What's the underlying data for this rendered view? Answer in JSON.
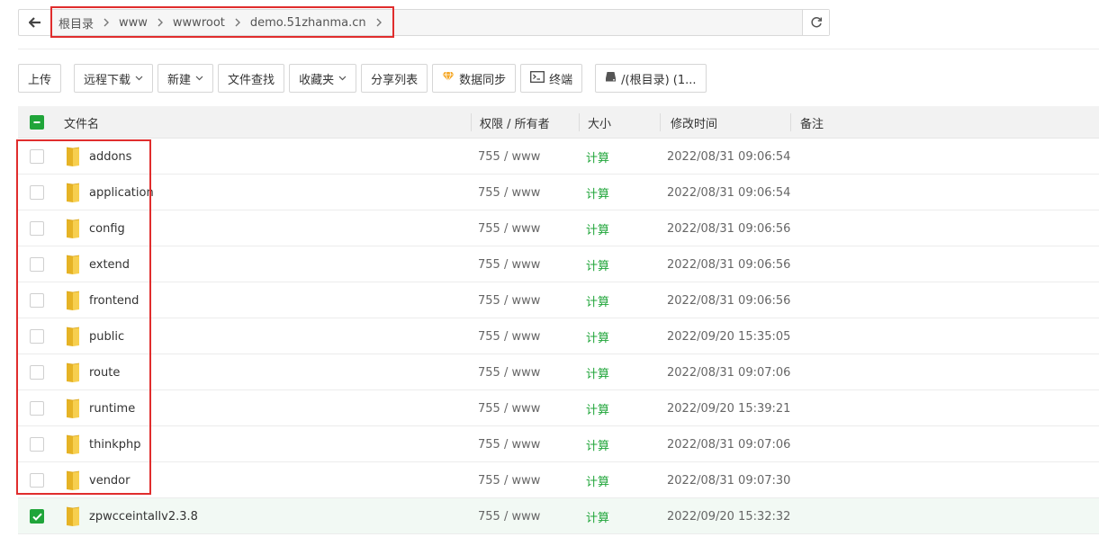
{
  "pathbar": {
    "crumbs": [
      "根目录",
      "www",
      "wwwroot",
      "demo.51zhanma.cn"
    ]
  },
  "toolbar": {
    "upload": "上传",
    "remote_download": "远程下载",
    "new": "新建",
    "file_search": "文件查找",
    "favorites": "收藏夹",
    "share_list": "分享列表",
    "data_sync": "数据同步",
    "terminal": "终端",
    "disk": "/(根目录) (1..."
  },
  "table": {
    "headers": {
      "name": "文件名",
      "perm": "权限 / 所有者",
      "size": "大小",
      "mtime": "修改时间",
      "remark": "备注"
    },
    "rows": [
      {
        "name": "addons",
        "perm": "755 / www",
        "size": "计算",
        "mtime": "2022/08/31 09:06:54",
        "checked": false
      },
      {
        "name": "application",
        "perm": "755 / www",
        "size": "计算",
        "mtime": "2022/08/31 09:06:54",
        "checked": false
      },
      {
        "name": "config",
        "perm": "755 / www",
        "size": "计算",
        "mtime": "2022/08/31 09:06:56",
        "checked": false
      },
      {
        "name": "extend",
        "perm": "755 / www",
        "size": "计算",
        "mtime": "2022/08/31 09:06:56",
        "checked": false
      },
      {
        "name": "frontend",
        "perm": "755 / www",
        "size": "计算",
        "mtime": "2022/08/31 09:06:56",
        "checked": false
      },
      {
        "name": "public",
        "perm": "755 / www",
        "size": "计算",
        "mtime": "2022/09/20 15:35:05",
        "checked": false
      },
      {
        "name": "route",
        "perm": "755 / www",
        "size": "计算",
        "mtime": "2022/08/31 09:07:06",
        "checked": false
      },
      {
        "name": "runtime",
        "perm": "755 / www",
        "size": "计算",
        "mtime": "2022/09/20 15:39:21",
        "checked": false
      },
      {
        "name": "thinkphp",
        "perm": "755 / www",
        "size": "计算",
        "mtime": "2022/08/31 09:07:06",
        "checked": false
      },
      {
        "name": "vendor",
        "perm": "755 / www",
        "size": "计算",
        "mtime": "2022/08/31 09:07:30",
        "checked": false
      },
      {
        "name": "zpwcceintallv2.3.8",
        "perm": "755 / www",
        "size": "计算",
        "mtime": "2022/09/20 15:32:32",
        "checked": true
      }
    ]
  },
  "colors": {
    "accent": "#20a53a",
    "highlight": "#e02d2d",
    "folder": "#f5c842"
  }
}
